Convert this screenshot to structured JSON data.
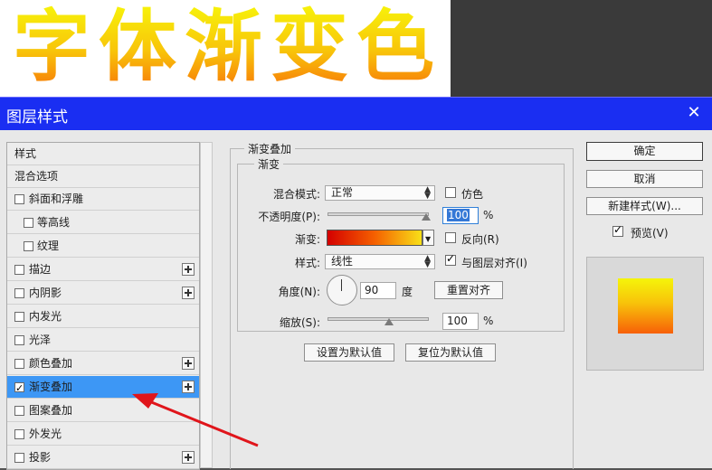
{
  "banner": {
    "title": "字体渐变色"
  },
  "dialog": {
    "title": "图层样式",
    "close_label": "✕"
  },
  "style_list": {
    "items": [
      {
        "label": "样式",
        "checkbox": false,
        "checked": false,
        "plus": false,
        "selected": false
      },
      {
        "label": "混合选项",
        "checkbox": false,
        "checked": false,
        "plus": false,
        "selected": false
      },
      {
        "label": "斜面和浮雕",
        "checkbox": true,
        "checked": false,
        "plus": false,
        "selected": false
      },
      {
        "label": "等高线",
        "checkbox": true,
        "checked": false,
        "plus": false,
        "selected": false,
        "indent": true
      },
      {
        "label": "纹理",
        "checkbox": true,
        "checked": false,
        "plus": false,
        "selected": false,
        "indent": true
      },
      {
        "label": "描边",
        "checkbox": true,
        "checked": false,
        "plus": true,
        "selected": false
      },
      {
        "label": "内阴影",
        "checkbox": true,
        "checked": false,
        "plus": true,
        "selected": false
      },
      {
        "label": "内发光",
        "checkbox": true,
        "checked": false,
        "plus": false,
        "selected": false
      },
      {
        "label": "光泽",
        "checkbox": true,
        "checked": false,
        "plus": false,
        "selected": false
      },
      {
        "label": "颜色叠加",
        "checkbox": true,
        "checked": false,
        "plus": true,
        "selected": false
      },
      {
        "label": "渐变叠加",
        "checkbox": true,
        "checked": true,
        "plus": true,
        "selected": true
      },
      {
        "label": "图案叠加",
        "checkbox": true,
        "checked": false,
        "plus": false,
        "selected": false
      },
      {
        "label": "外发光",
        "checkbox": true,
        "checked": false,
        "plus": false,
        "selected": false
      },
      {
        "label": "投影",
        "checkbox": true,
        "checked": false,
        "plus": true,
        "selected": false
      }
    ]
  },
  "panel": {
    "group_title": "渐变叠加",
    "subgroup_title": "渐变",
    "blend_mode_label": "混合模式:",
    "blend_mode_value": "正常",
    "dither_label": "仿色",
    "opacity_label": "不透明度(P):",
    "opacity_value": "100",
    "opacity_unit": "%",
    "gradient_label": "渐变:",
    "reverse_label": "反向(R)",
    "style_label": "样式:",
    "style_value": "线性",
    "align_label": "与图层对齐(I)",
    "angle_label": "角度(N):",
    "angle_value": "90",
    "angle_unit": "度",
    "reset_align_label": "重置对齐",
    "scale_label": "缩放(S):",
    "scale_value": "100",
    "scale_unit": "%",
    "set_default_label": "设置为默认值",
    "reset_default_label": "复位为默认值"
  },
  "right": {
    "ok_label": "确定",
    "cancel_label": "取消",
    "new_style_label": "新建样式(W)...",
    "preview_label": "预览(V)"
  },
  "colors": {
    "titlebar": "#1a2ef2",
    "selected_row": "#3d97f5",
    "arrow": "#e0151b"
  }
}
